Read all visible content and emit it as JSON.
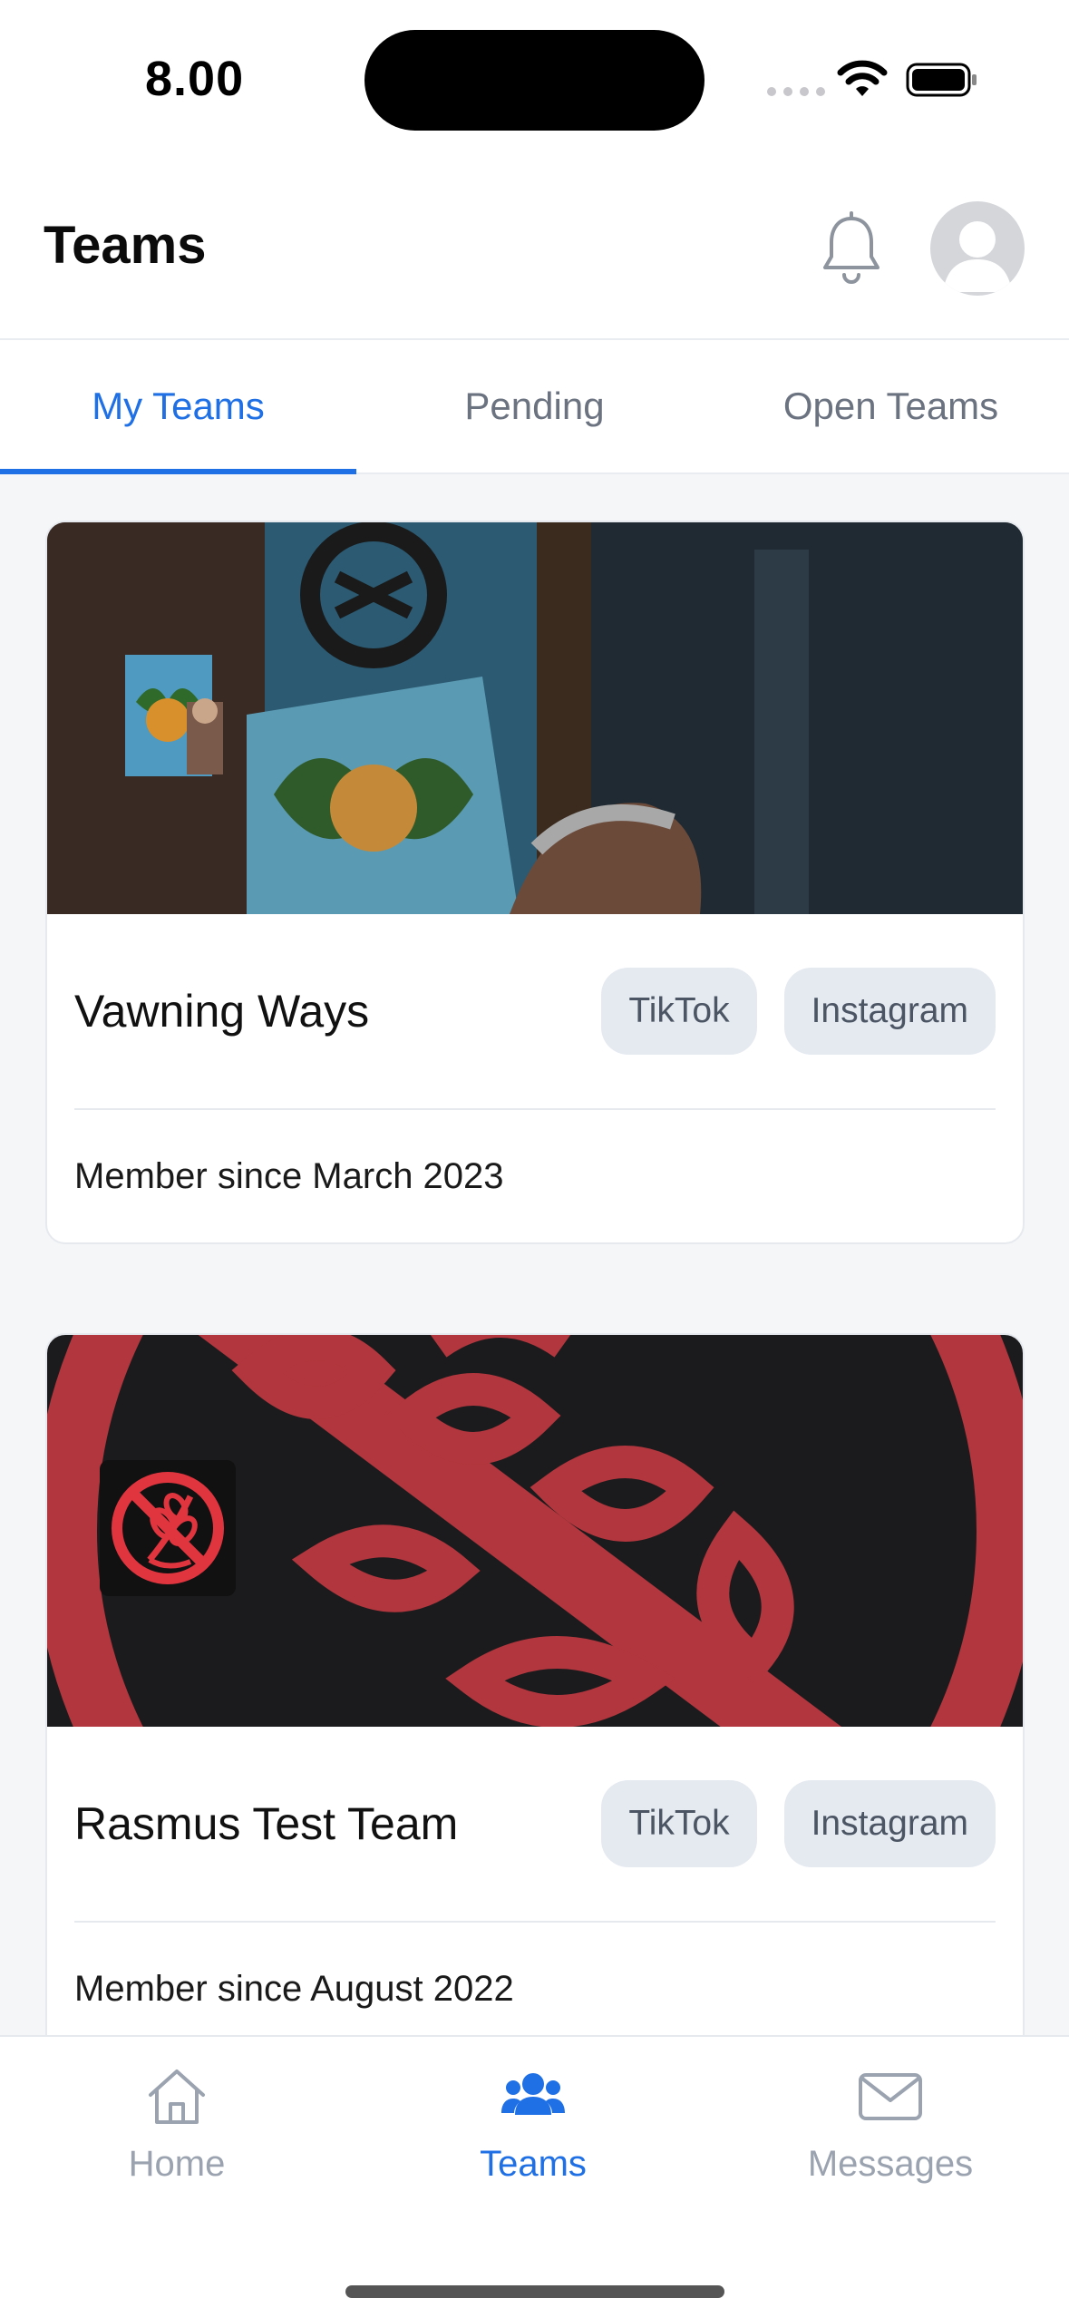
{
  "status_bar": {
    "time": "8.00",
    "icons": [
      "cellular-dots-icon",
      "wifi-icon",
      "battery-icon"
    ]
  },
  "header": {
    "title": "Teams",
    "icons": [
      "bell-icon",
      "avatar"
    ]
  },
  "tabs": [
    {
      "label": "My Teams",
      "active": true
    },
    {
      "label": "Pending",
      "active": false
    },
    {
      "label": "Open Teams",
      "active": false
    }
  ],
  "teams": [
    {
      "name": "Vawning Ways",
      "platforms": [
        "TikTok",
        "Instagram"
      ],
      "member_since": "Member since March 2023"
    },
    {
      "name": "Rasmus Test Team",
      "platforms": [
        "TikTok",
        "Instagram"
      ],
      "member_since": "Member since August 2022"
    }
  ],
  "bottom_nav": [
    {
      "label": "Home",
      "icon": "home-icon",
      "active": false
    },
    {
      "label": "Teams",
      "icon": "users-icon",
      "active": true
    },
    {
      "label": "Messages",
      "icon": "envelope-icon",
      "active": false
    }
  ],
  "colors": {
    "accent": "#1f6fe5",
    "inactive": "#9aa3af",
    "chip_bg": "#e5eaf1",
    "banner_red": "#b1363d"
  }
}
